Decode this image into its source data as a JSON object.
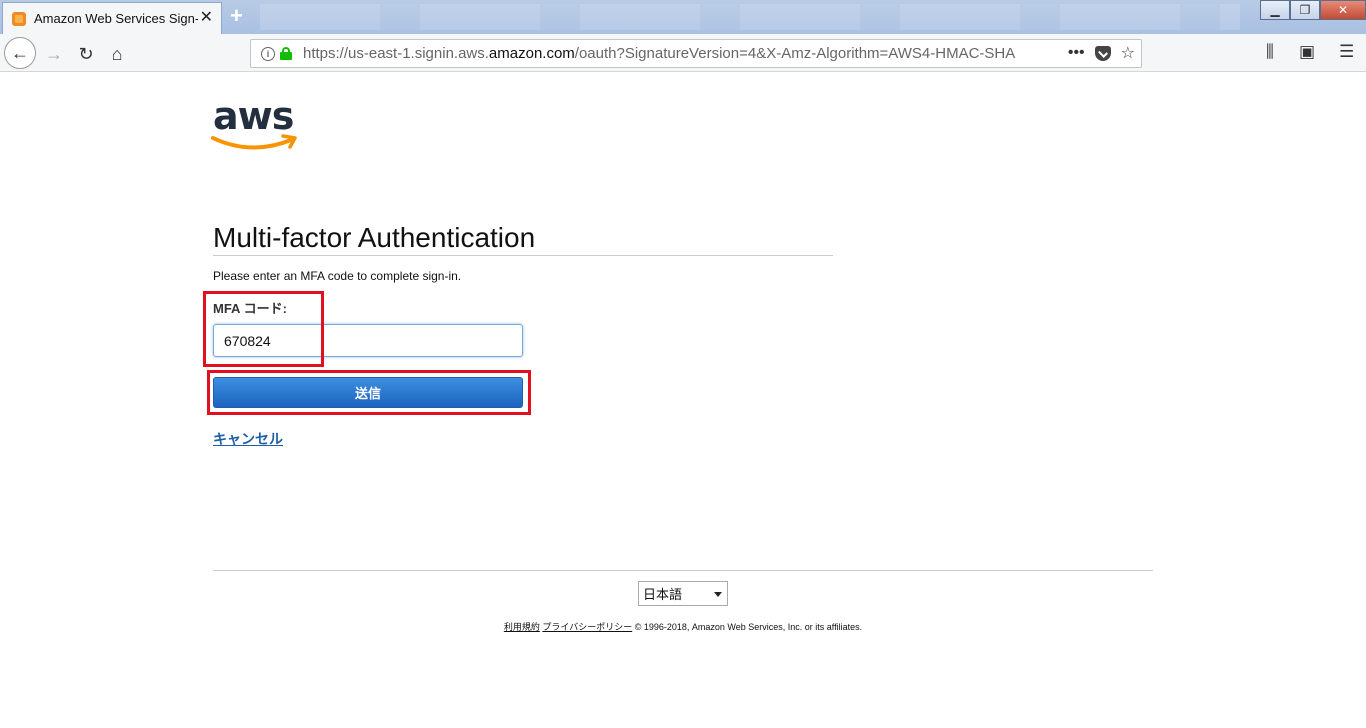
{
  "browser": {
    "tab_title": "Amazon Web Services Sign-In",
    "url_prefix": "https://us-east-1.signin.aws.",
    "url_domain": "amazon.com",
    "url_suffix": "/oauth?SignatureVersion=4&X-Amz-Algorithm=AWS4-HMAC-SHA"
  },
  "page": {
    "logo_text": "aws",
    "title": "Multi-factor Authentication",
    "intro": "Please enter an MFA code to complete sign-in.",
    "mfa_label": "MFA コード:",
    "mfa_value": "670824",
    "submit_label": "送信",
    "cancel_label": "キャンセル"
  },
  "footer": {
    "language": "日本語",
    "terms_link": "利用規約",
    "privacy_link": "プライバシーポリシー",
    "copyright": "© 1996-2018, Amazon Web Services, Inc. or its affiliates."
  },
  "colors": {
    "accent_button": "#1c64bf",
    "highlight": "#e01020",
    "logo_smile": "#f79400"
  }
}
